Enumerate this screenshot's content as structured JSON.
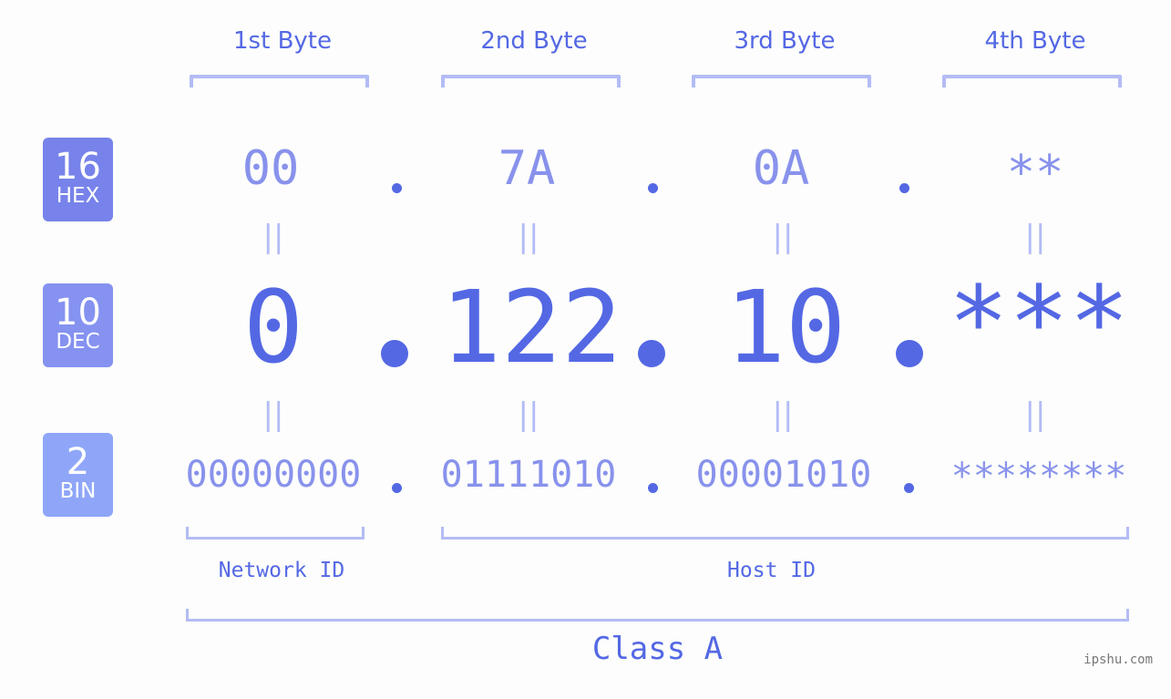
{
  "colors": {
    "accent": "#5468e4",
    "light_accent": "#8892ec",
    "bracket": "#b3bcf5",
    "hex_badge": "#7783ea",
    "dec_badge": "#8592f0",
    "bin_badge": "#8fa6f8",
    "background": "#fcfdfc"
  },
  "bytes": [
    {
      "label": "1st Byte",
      "hex": "00",
      "dec": "0",
      "bin": "00000000"
    },
    {
      "label": "2nd Byte",
      "hex": "7A",
      "dec": "122",
      "bin": "01111010"
    },
    {
      "label": "3rd Byte",
      "hex": "0A",
      "dec": "10",
      "bin": "00001010"
    },
    {
      "label": "4th Byte",
      "hex": "**",
      "dec": "***",
      "bin": "********"
    }
  ],
  "bases": {
    "hex": {
      "num": "16",
      "name": "HEX"
    },
    "dec": {
      "num": "10",
      "name": "DEC"
    },
    "bin": {
      "num": "2",
      "name": "BIN"
    }
  },
  "equals_sign": "||",
  "sections": {
    "network": "Network ID",
    "host": "Host ID",
    "class": "Class A"
  },
  "watermark": "ipshu.com"
}
